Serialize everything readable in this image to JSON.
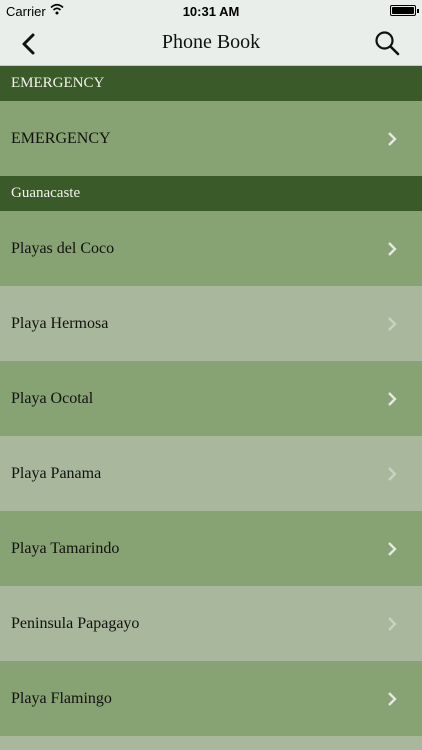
{
  "status": {
    "carrier": "Carrier",
    "time": "10:31 AM"
  },
  "nav": {
    "title": "Phone Book"
  },
  "sections": [
    {
      "header": "EMERGENCY",
      "items": [
        "EMERGENCY"
      ]
    },
    {
      "header": "Guanacaste",
      "items": [
        "Playas del Coco",
        "Playa Hermosa",
        "Playa Ocotal",
        "Playa Panama",
        "Playa Tamarindo",
        "Peninsula Papagayo",
        "Playa Flamingo"
      ]
    }
  ],
  "colors": {
    "header": "#3b5a2a",
    "row_dark": "#87a273",
    "row_light": "#a9b89c",
    "bar": "#e9eeea"
  }
}
